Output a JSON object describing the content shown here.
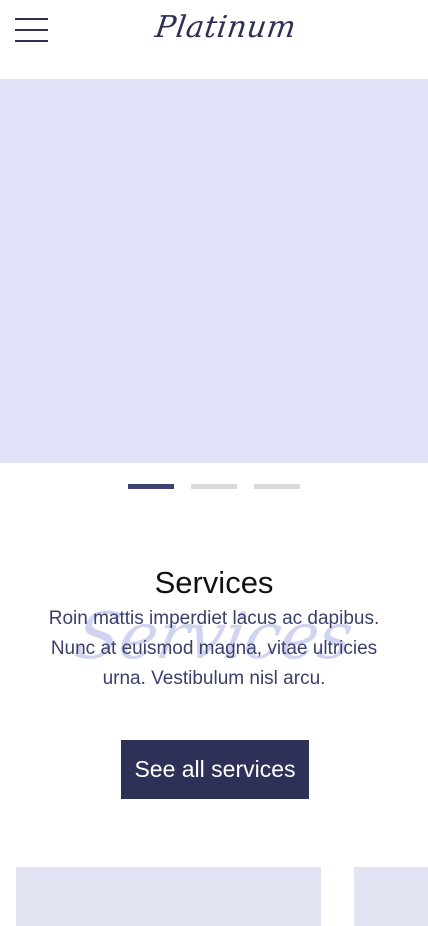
{
  "header": {
    "logo_text": "Platinum"
  },
  "carousel": {
    "slide_count": 3,
    "active_index": 0
  },
  "services": {
    "title": "Services",
    "watermark": "Services",
    "description": "Roin mattis imperdiet lacus ac dapibus. Nunc at euismod magna, vitae ultricies urna. Vestibulum nisl arcu.",
    "cta_label": "See all services"
  },
  "colors": {
    "brand_navy": "#2d3157",
    "hero_bg": "#e1e3f8",
    "card_bg": "#e2e3f3",
    "dot_active": "#3f4275",
    "dot_inactive": "#d9d9d9"
  },
  "icons": {
    "menu": "hamburger-menu-icon"
  }
}
